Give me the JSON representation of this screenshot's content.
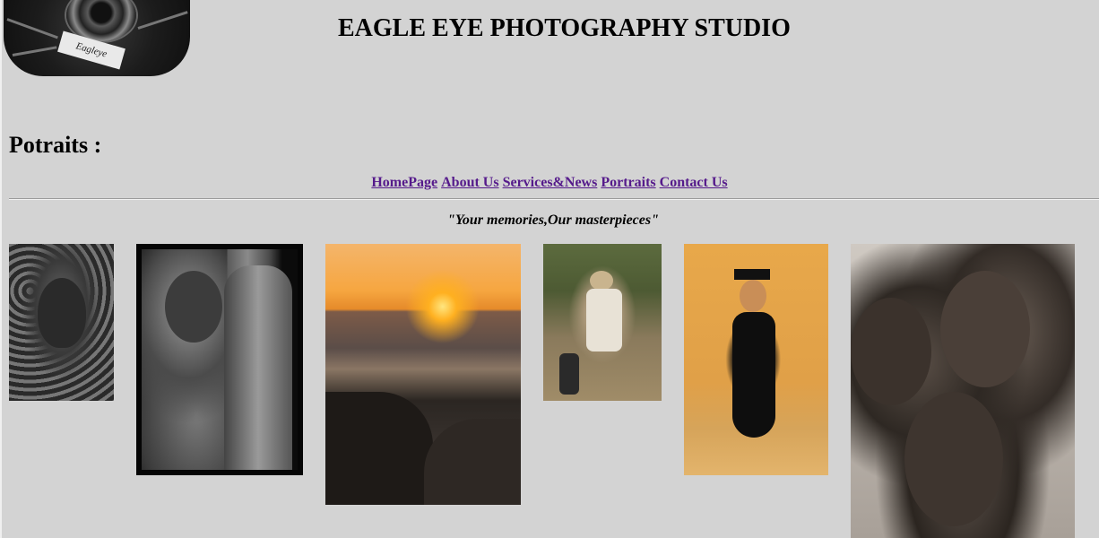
{
  "header": {
    "logo_alt": "Eagleye",
    "title": "EAGLE EYE PHOTOGRAPHY STUDIO"
  },
  "section": {
    "title": "Potraits :"
  },
  "nav": {
    "items": [
      {
        "label": "HomePage"
      },
      {
        "label": "About Us"
      },
      {
        "label": "Services&News"
      },
      {
        "label": "Portraits"
      },
      {
        "label": "Contact Us"
      }
    ]
  },
  "tagline": "\"Your memories,Our masterpieces\"",
  "colors": {
    "background": "#d3d3d3",
    "link_visited": "#551a8b",
    "text": "#000000"
  },
  "gallery": {
    "photos": [
      {
        "subject": "chained-portrait"
      },
      {
        "subject": "child-with-drum"
      },
      {
        "subject": "sunset-seascape"
      },
      {
        "subject": "woman-reading-outdoors"
      },
      {
        "subject": "graduate-portrait"
      },
      {
        "subject": "laughing-friends"
      }
    ]
  }
}
